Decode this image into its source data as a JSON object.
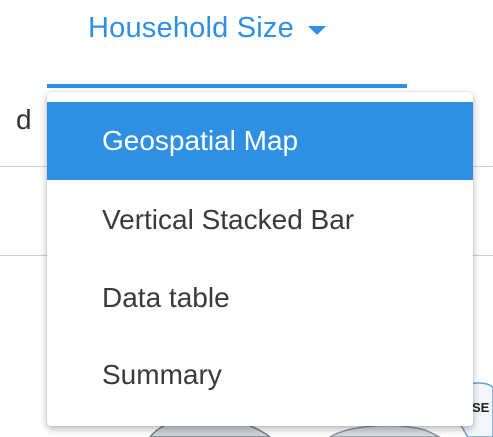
{
  "tab": {
    "label": "Household Size"
  },
  "background": {
    "partial_text": "d",
    "map_label": "SE"
  },
  "menu": {
    "items": [
      {
        "label": "Geospatial Map",
        "selected": true
      },
      {
        "label": "Vertical Stacked Bar",
        "selected": false
      },
      {
        "label": "Data table",
        "selected": false
      },
      {
        "label": "Summary",
        "selected": false
      }
    ]
  },
  "colors": {
    "accent": "#2f8fe3",
    "menu_text": "#3a3a3a",
    "rule": "#cfcfcf"
  },
  "icons": {
    "dropdown": "caret-down-icon"
  }
}
